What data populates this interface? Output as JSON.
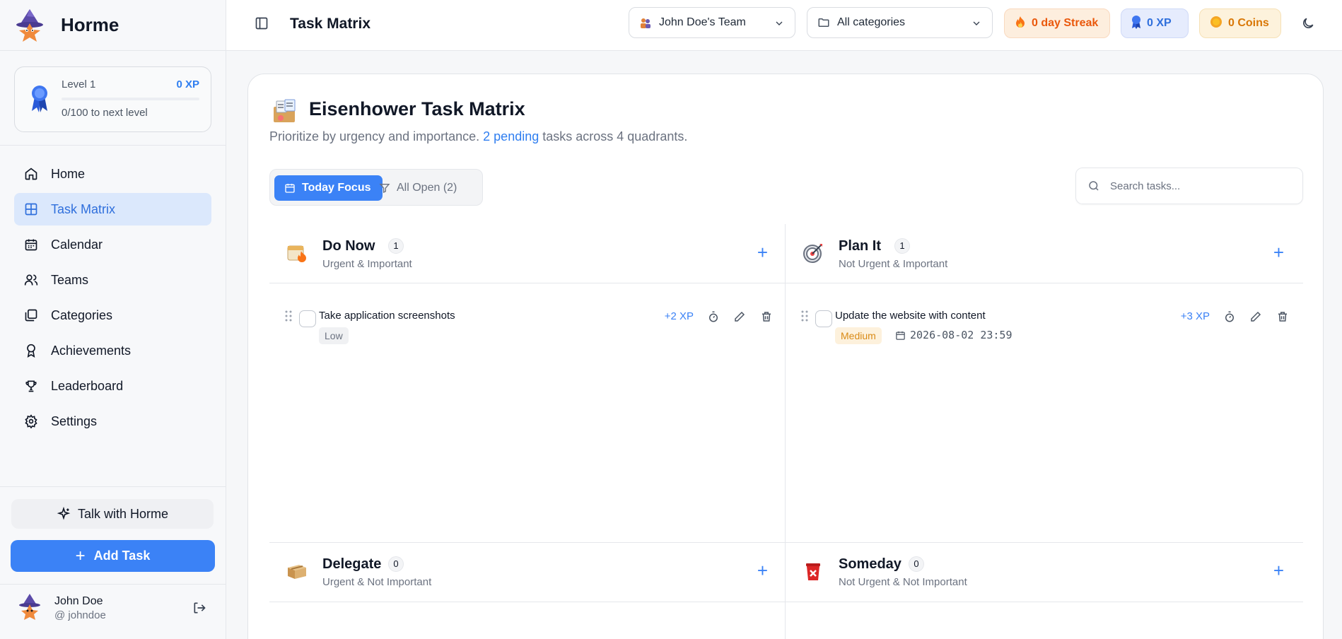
{
  "brand": {
    "name": "Horme"
  },
  "level": {
    "title": "Level 1",
    "xp": "0 XP",
    "progress_text": "0/100 to next level",
    "progress": 0
  },
  "nav": {
    "items": [
      {
        "label": "Home",
        "icon": "home-icon"
      },
      {
        "label": "Task Matrix",
        "icon": "grid-icon",
        "active": true
      },
      {
        "label": "Calendar",
        "icon": "calendar-icon"
      },
      {
        "label": "Teams",
        "icon": "users-icon"
      },
      {
        "label": "Categories",
        "icon": "folders-icon"
      },
      {
        "label": "Achievements",
        "icon": "award-icon"
      },
      {
        "label": "Leaderboard",
        "icon": "trophy-icon"
      },
      {
        "label": "Settings",
        "icon": "gear-icon"
      }
    ]
  },
  "actions": {
    "talk": "Talk with Horme",
    "add_task": "Add Task"
  },
  "user": {
    "name": "John Doe",
    "handle": "@ johndoe"
  },
  "topbar": {
    "title": "Task Matrix",
    "team_select": "John Doe's Team",
    "category_select": "All categories",
    "streak": "0 day Streak",
    "xp": "0 XP",
    "coins": "0 Coins"
  },
  "matrix": {
    "title": "Eisenhower Task Matrix",
    "subtitle_pre": "Prioritize by urgency and importance. ",
    "pending": "2 pending",
    "subtitle_post": " tasks across 4 quadrants.",
    "tab_today": "Today Focus",
    "tab_all": "All Open (2)",
    "search_placeholder": "Search tasks..."
  },
  "quadrants": [
    {
      "name": "Do Now",
      "count": "1",
      "desc": "Urgent & Important",
      "tasks": [
        {
          "title": "Take application screenshots",
          "xp": "+2 XP",
          "priority": "Low"
        }
      ]
    },
    {
      "name": "Plan It",
      "count": "1",
      "desc": "Not Urgent & Important",
      "tasks": [
        {
          "title": "Update the website with content",
          "xp": "+3 XP",
          "priority": "Medium",
          "due": "2026-08-02 23:59"
        }
      ]
    },
    {
      "name": "Delegate",
      "count": "0",
      "desc": "Urgent & Not Important",
      "tasks": []
    },
    {
      "name": "Someday",
      "count": "0",
      "desc": "Not Urgent & Not Important",
      "tasks": []
    }
  ],
  "colors": {
    "accent": "#3b82f6",
    "streak_bg": "#fdeede",
    "xp_bg": "#e6ecfd",
    "coins_bg": "#fdf2dc"
  }
}
